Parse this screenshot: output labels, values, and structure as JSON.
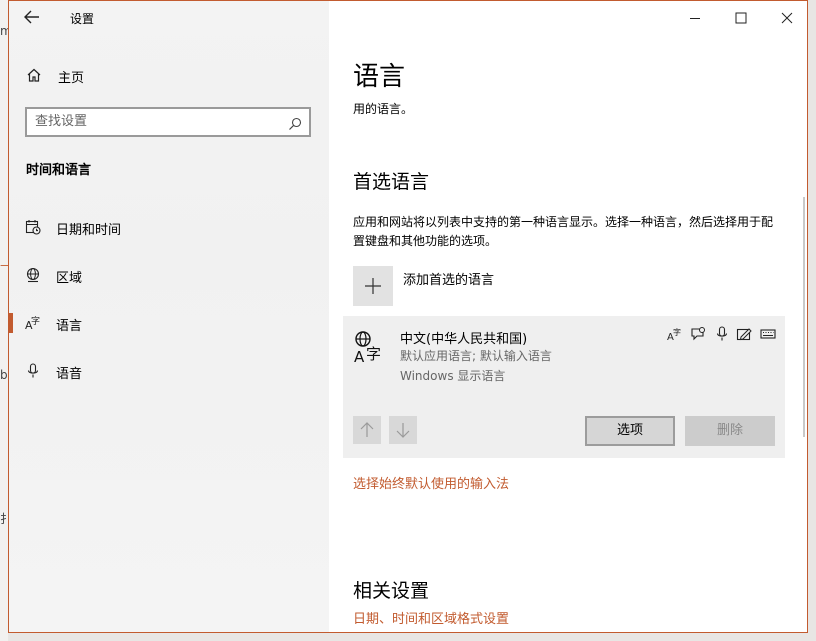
{
  "window": {
    "title": "设置"
  },
  "sidebar": {
    "home_label": "主页",
    "search_placeholder": "查找设置",
    "section_label": "时间和语言",
    "items": [
      {
        "label": "日期和时间",
        "icon": "calendar-clock-icon",
        "selected": false
      },
      {
        "label": "区域",
        "icon": "globe-icon",
        "selected": false
      },
      {
        "label": "语言",
        "icon": "language-icon",
        "selected": true
      },
      {
        "label": "语音",
        "icon": "microphone-icon",
        "selected": false
      }
    ]
  },
  "main": {
    "title": "语言",
    "subtitle": "用的语言。",
    "preferred_heading": "首选语言",
    "preferred_desc": "应用和网站将以列表中支持的第一种语言显示。选择一种语言，然后选择用于配置键盘和其他功能的选项。",
    "add_label": "添加首选的语言",
    "language": {
      "name": "中文(中华人民共和国)",
      "line2": "默认应用语言; 默认输入语言",
      "line3": "Windows 显示语言",
      "feature_icons": [
        "display-language-icon",
        "speech-icon",
        "microphone-icon",
        "handwriting-icon",
        "keyboard-icon"
      ]
    },
    "options_label": "选项",
    "remove_label": "删除",
    "input_method_link": "选择始终默认使用的输入法",
    "related_heading": "相关设置",
    "related_link": "日期、时间和区域格式设置"
  },
  "colors": {
    "accent": "#c25b2f",
    "sidebar_bg": "#f2f2f2",
    "card_bg": "#efefef"
  }
}
